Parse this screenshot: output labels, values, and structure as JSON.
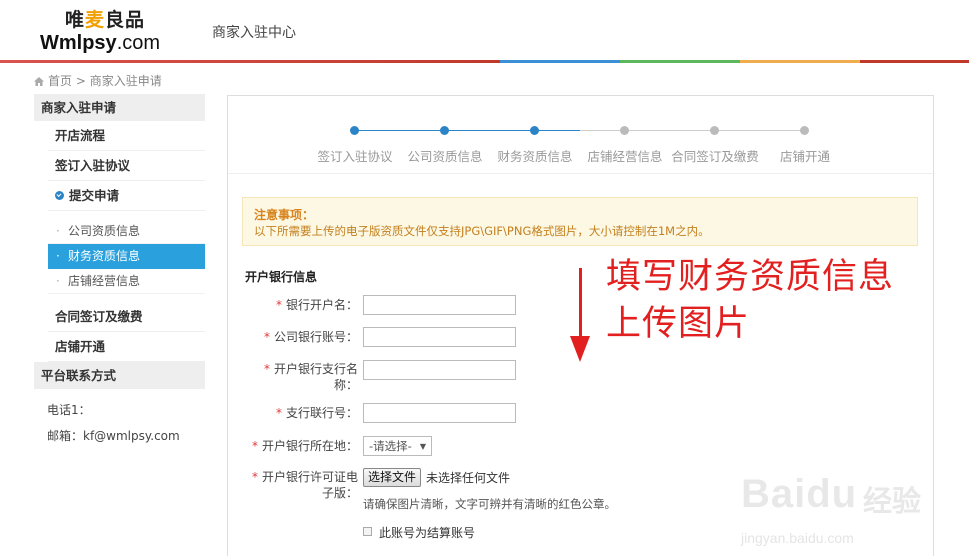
{
  "header": {
    "logo_cn_1": "唯",
    "logo_cn_2": "麦",
    "logo_cn_3": "良品",
    "logo_en": "Wmlpsy",
    "logo_en_suffix": ".com",
    "title": "商家入驻中心"
  },
  "breadcrumb": {
    "home": "首页",
    "separator": ">",
    "current": "商家入驻申请"
  },
  "sidebar": {
    "heading": "商家入驻申请",
    "items": [
      {
        "label": "开店流程"
      },
      {
        "label": "签订入驻协议"
      },
      {
        "label": "提交申请"
      }
    ],
    "subitems": [
      {
        "label": "公司资质信息"
      },
      {
        "label": "财务资质信息"
      },
      {
        "label": "店铺经营信息"
      }
    ],
    "items_after": [
      {
        "label": "合同签订及缴费"
      },
      {
        "label": "店铺开通"
      }
    ],
    "contact_heading": "平台联系方式",
    "phone": "电话1：",
    "email": "邮箱：kf@wmlpsy.com"
  },
  "steps": [
    {
      "label": "签订入驻协议",
      "done": true
    },
    {
      "label": "公司资质信息",
      "done": true
    },
    {
      "label": "财务资质信息",
      "done": true
    },
    {
      "label": "店铺经营信息",
      "done": false
    },
    {
      "label": "合同签订及缴费",
      "done": false
    },
    {
      "label": "店铺开通",
      "done": false
    }
  ],
  "colors": {
    "step_done": "#2a84c6",
    "step_todo": "#bbbbbb",
    "active_nav": "#2aa1dd",
    "annotation": "#e22020"
  },
  "notice": {
    "title": "注意事项：",
    "text": "以下所需要上传的电子版资质文件仅支持JPG\\GIF\\PNG格式图片，大小请控制在1M之内。"
  },
  "form": {
    "section_title": "开户银行信息",
    "required_mark": "*",
    "fields": {
      "account_name": {
        "label": "银行开户名：",
        "value": ""
      },
      "account_number": {
        "label": "公司银行账号：",
        "value": ""
      },
      "branch_name": {
        "label_1": "开户银行支行名",
        "label_2": "称：",
        "value": ""
      },
      "branch_code": {
        "label": "支行联行号：",
        "value": ""
      },
      "bank_location": {
        "label": "开户银行所在地：",
        "selected": "-请选择-"
      },
      "license": {
        "label_1": "开户银行许可证电",
        "label_2": "子版：",
        "button": "选择文件",
        "status": "未选择任何文件",
        "hint": "请确保图片清晰，文字可辨并有清晰的红色公章。"
      }
    },
    "settlement_checkbox": {
      "label": "此账号为结算账号",
      "checked": false
    }
  },
  "annotation": {
    "line1": "填写财务资质信息",
    "line2": "上传图片"
  },
  "watermark": {
    "main": "Bai",
    "paw": "du",
    "cn": "经验",
    "url": "jingyan.baidu.com"
  }
}
